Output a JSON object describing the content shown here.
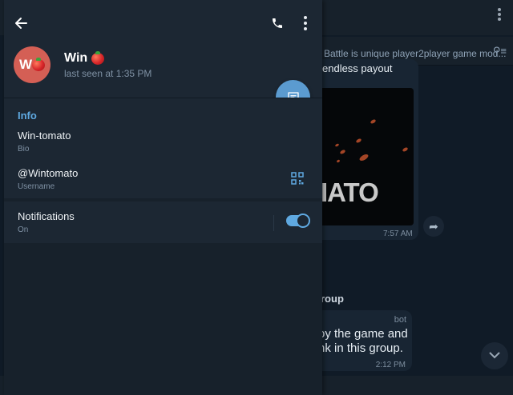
{
  "background_chat": {
    "pinned_text": "Battle is unique player2player game mod...",
    "message1_text": "endless payout",
    "media_caption": "IATO",
    "message1_time": "7:57 AM",
    "group_text": "roup",
    "message2_sender": "bot",
    "message2_line1": "oy the game and",
    "message2_line2": "nk in this group.",
    "message2_time": "2:12 PM"
  },
  "profile": {
    "avatar_initial": "W",
    "name": "Win",
    "last_seen": "last seen at 1:35 PM"
  },
  "info": {
    "section_title": "Info",
    "bio_value": "Win-tomato",
    "bio_label": "Bio",
    "username_value": "@Wintomato",
    "username_label": "Username"
  },
  "notifications": {
    "label": "Notifications",
    "status": "On",
    "enabled": true
  },
  "colors": {
    "accent": "#5fa9e1",
    "avatar_bg": "#d45f55",
    "fab_bg": "#5b9bd0",
    "panel_bg": "#1c2733"
  }
}
